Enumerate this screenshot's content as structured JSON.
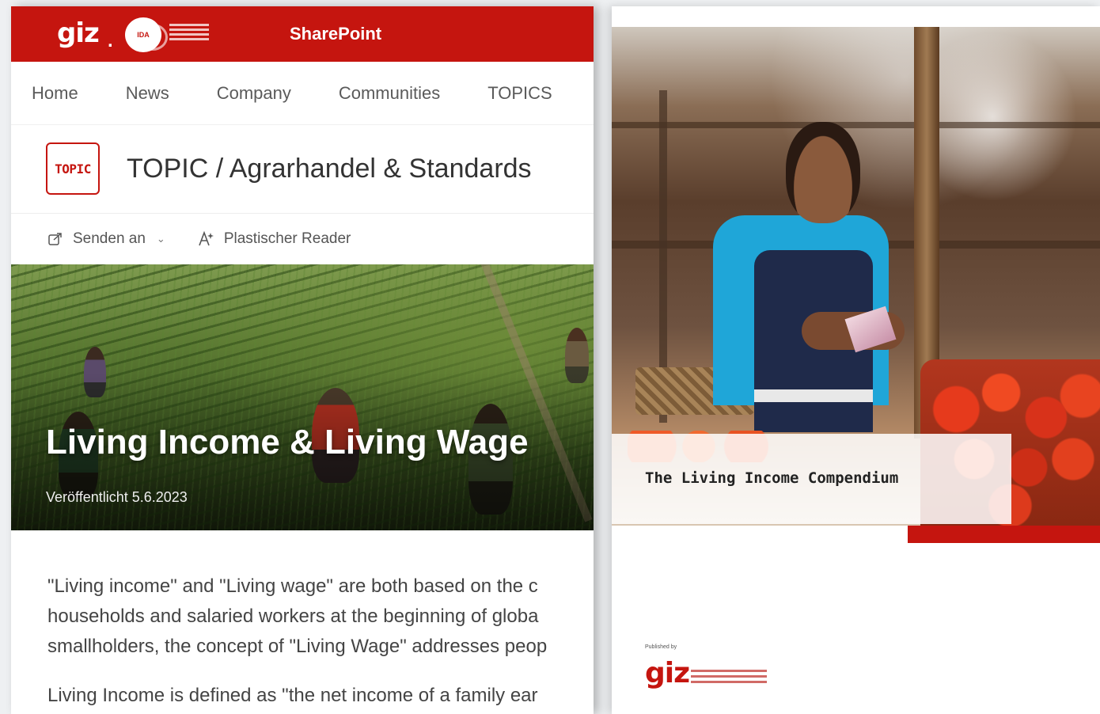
{
  "sharepoint": {
    "logo_text": "giz",
    "logo_dot": ".",
    "ida_badge": "IDA",
    "brand": "SharePoint",
    "nav": [
      "Home",
      "News",
      "Company",
      "Communities",
      "TOPICS"
    ],
    "topic_badge": "TOPIC",
    "page_title": "TOPIC / Agrarhandel & Standards",
    "commands": {
      "send_to": "Senden an",
      "immersive_reader": "Plastischer Reader"
    },
    "hero": {
      "title": "Living Income & Living Wage",
      "published": "Veröffentlicht 5.6.2023"
    },
    "body": {
      "p1_line1": "\"Living income\" and \"Living wage\" are both based on the c",
      "p1_line2": "households and salaried workers at the beginning of globa",
      "p1_line3": "smallholders, the concept of \"Living Wage\" addresses peop",
      "p2_line1": "Living Income is defined as \"the net income of a family ear"
    }
  },
  "cover": {
    "title": "The Living Income Compendium",
    "published_by": "Published by",
    "logo_text": "giz"
  },
  "colors": {
    "brand_red": "#c5150f",
    "nav_text": "#5a5a5a",
    "title_text": "#333333"
  }
}
